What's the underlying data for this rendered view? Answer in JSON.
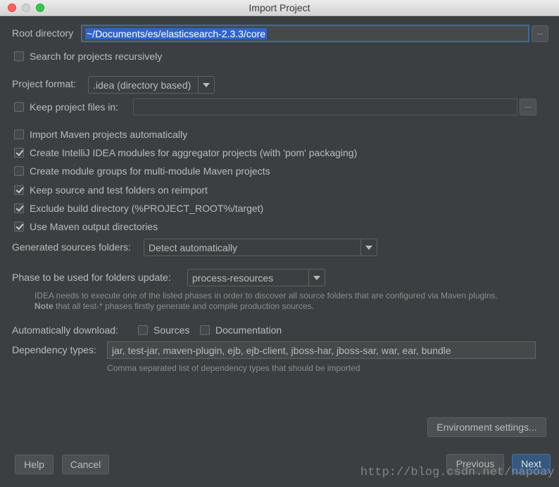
{
  "window": {
    "title": "Import Project"
  },
  "root_directory": {
    "label": "Root directory",
    "value": "~/Documents/es/elasticsearch-2.3.3/core",
    "browse": "..."
  },
  "search_recursively": {
    "label": "Search for projects recursively",
    "checked": false
  },
  "project_format": {
    "label": "Project format:",
    "value": ".idea (directory based)"
  },
  "keep_project_files": {
    "label": "Keep project files in:",
    "checked": false,
    "value": "",
    "browse": "..."
  },
  "options": [
    {
      "label": "Import Maven projects automatically",
      "checked": false
    },
    {
      "label": "Create IntelliJ IDEA modules for aggregator projects (with 'pom' packaging)",
      "checked": true
    },
    {
      "label": "Create module groups for multi-module Maven projects",
      "checked": false
    },
    {
      "label": "Keep source and test folders on reimport",
      "checked": true
    },
    {
      "label": "Exclude build directory (%PROJECT_ROOT%/target)",
      "checked": true
    },
    {
      "label": "Use Maven output directories",
      "checked": true
    }
  ],
  "generated_sources": {
    "label": "Generated sources folders:",
    "value": "Detect automatically"
  },
  "phase": {
    "label": "Phase to be used for folders update:",
    "value": "process-resources"
  },
  "phase_hint": {
    "line1": "IDEA needs to execute one of the listed phases in order to discover all source folders that are configured via Maven plugins.",
    "line2_bold": "Note",
    "line2_rest": " that all test-* phases firstly generate and compile production sources."
  },
  "auto_download": {
    "label": "Automatically download:",
    "sources": "Sources",
    "sources_checked": false,
    "documentation": "Documentation",
    "documentation_checked": false
  },
  "dependency_types": {
    "label": "Dependency types:",
    "value": "jar, test-jar, maven-plugin, ejb, ejb-client, jboss-har, jboss-sar, war, ear, bundle",
    "hint": "Comma separated list of dependency types that should be imported"
  },
  "buttons": {
    "environment": "Environment settings...",
    "help": "Help",
    "cancel": "Cancel",
    "previous": "Previous",
    "next": "Next"
  },
  "watermark": "http://blog.csdn.net/napoay"
}
